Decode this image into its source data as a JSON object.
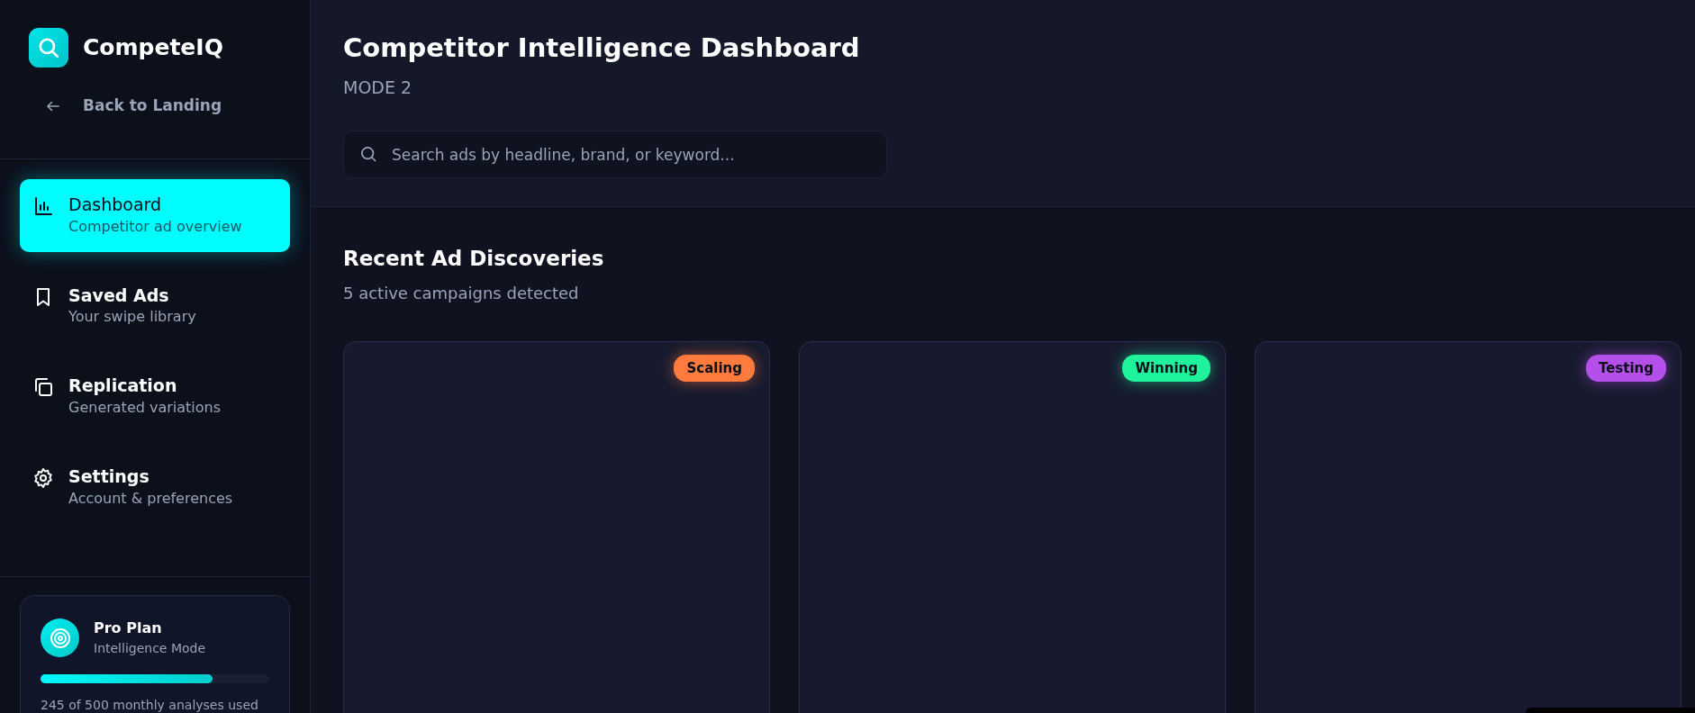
{
  "brand": {
    "name": "CompeteIQ"
  },
  "back_link": {
    "label": "Back to Landing"
  },
  "nav_items": [
    {
      "kind": "chart",
      "title": "Dashboard",
      "subtitle": "Competitor ad overview",
      "selected": true
    },
    {
      "kind": "bookmark",
      "title": "Saved Ads",
      "subtitle": "Your swipe library",
      "selected": false
    },
    {
      "kind": "copy",
      "title": "Replication",
      "subtitle": "Generated variations",
      "selected": false
    },
    {
      "kind": "gear",
      "title": "Settings",
      "subtitle": "Account & preferences",
      "selected": false
    }
  ],
  "plan": {
    "title": "Pro Plan",
    "subtitle": "Intelligence Mode",
    "level": 0.75,
    "usage": "245 of 500 monthly analyses used"
  },
  "header": {
    "title": "Competitor Intelligence Dashboard",
    "subtitle": "MODE 2"
  },
  "search": {
    "placeholder": "Search ads by headline, brand, or keyword..."
  },
  "section": {
    "title": "Recent Ad Discoveries",
    "subtitle": "5 active campaigns detected"
  },
  "ads": [
    {
      "status": "Scaling",
      "color": "#ff7a3d"
    },
    {
      "status": "Winning",
      "color": "#1ef29a"
    },
    {
      "status": "Testing",
      "color": "#b44fea"
    }
  ]
}
